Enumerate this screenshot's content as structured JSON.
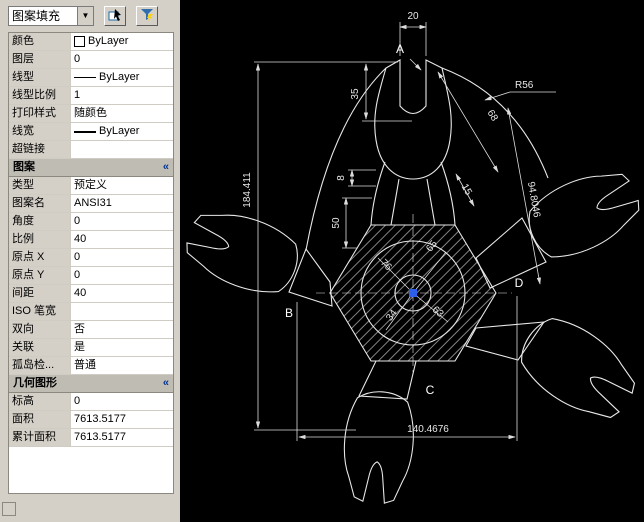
{
  "window": {
    "bg": "#d4d0c8",
    "canvas_bg": "#000000"
  },
  "palette": {
    "selector": {
      "value": "图案填充",
      "dropdown_icon": "▼"
    },
    "toolbar_icons": [
      "select-objects",
      "quick-select"
    ],
    "general_rows": [
      {
        "label": "颜色",
        "value": "ByLayer"
      },
      {
        "label": "图层",
        "value": "0"
      },
      {
        "label": "线型",
        "value": "ByLayer"
      },
      {
        "label": "线型比例",
        "value": "1"
      },
      {
        "label": "打印样式",
        "value": "随颜色"
      },
      {
        "label": "线宽",
        "value": "ByLayer"
      },
      {
        "label": "超链接",
        "value": ""
      }
    ],
    "pattern_section": {
      "title": "图案",
      "collapse_icon": "«",
      "rows": [
        {
          "label": "类型",
          "value": "预定义"
        },
        {
          "label": "图案名",
          "value": "ANSI31"
        },
        {
          "label": "角度",
          "value": "0"
        },
        {
          "label": "比例",
          "value": "40"
        },
        {
          "label": "原点 X",
          "value": "0"
        },
        {
          "label": "原点 Y",
          "value": "0"
        },
        {
          "label": "间距",
          "value": "40"
        },
        {
          "label": "ISO 笔宽",
          "value": ""
        },
        {
          "label": "双向",
          "value": "否"
        },
        {
          "label": "关联",
          "value": "是"
        },
        {
          "label": "孤岛检...",
          "value": "普通"
        }
      ]
    },
    "geometry_section": {
      "title": "几何图形",
      "collapse_icon": "«",
      "rows": [
        {
          "label": "标高",
          "value": "0"
        },
        {
          "label": "面积",
          "value": "7613.5177"
        },
        {
          "label": "累计面积",
          "value": "7613.5177"
        }
      ]
    }
  },
  "drawing": {
    "grip_color": "#2e5fe8",
    "line_color": "#e8e8e8",
    "point_labels": {
      "a": "A",
      "b": "B",
      "c": "C",
      "d": "D"
    },
    "dimensions": {
      "slot_width": "20",
      "slot_depth": "35",
      "step": "8",
      "neck_length": "50",
      "total_height": "184.411",
      "total_width": "140.4676",
      "arc_radius": "R56",
      "edge_68": "68",
      "edge_15": "15",
      "diagonal": "94.8046",
      "inner_76": "76",
      "inner_65": "65",
      "inner_34": "34",
      "inner_63": "63"
    }
  }
}
